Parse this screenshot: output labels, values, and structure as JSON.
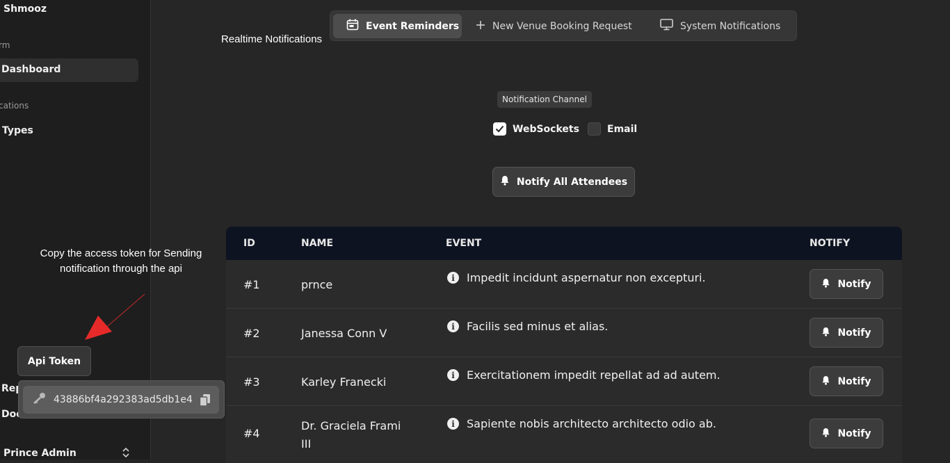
{
  "sidebar": {
    "brand": "Shmooz",
    "section_platform": "rm",
    "dashboard": "Dashboard",
    "section_notifications": "cations",
    "types": "Types",
    "reports_cut": "Rep",
    "docs_cut": "Doc",
    "user_name": "Prince Admin"
  },
  "tabs": [
    {
      "label": "Event Reminders",
      "icon": "calendar-icon"
    },
    {
      "label": "New Venue Booking Request",
      "icon": "plus-icon"
    },
    {
      "label": "System Notifications",
      "icon": "monitor-icon"
    }
  ],
  "realtime_label": "Realtime Notifications",
  "channel": {
    "badge": "Notification Channel",
    "websockets": "WebSockets",
    "email": "Email",
    "websockets_checked": true,
    "email_checked": false
  },
  "notify_all": "Notify All Attendees",
  "table": {
    "headers": {
      "id": "ID",
      "name": "NAME",
      "event": "EVENT",
      "notify": "NOTIFY"
    },
    "rows": [
      {
        "id": "#1",
        "name": "prnce",
        "event": "Impedit incidunt aspernatur non excepturi.",
        "action": "Notify"
      },
      {
        "id": "#2",
        "name": "Janessa Conn V",
        "event": "Facilis sed minus et alias.",
        "action": "Notify"
      },
      {
        "id": "#3",
        "name": "Karley Franecki",
        "event": "Exercitationem impedit repellat ad ad autem.",
        "action": "Notify"
      },
      {
        "id": "#4",
        "name": "Dr. Graciela Frami III",
        "event": "Sapiente nobis architecto architecto odio ab.",
        "action": "Notify"
      }
    ]
  },
  "annotation": "Copy the access token for Sending notification through the api",
  "api_token": {
    "button": "Api Token",
    "value": "43886bf4a292383ad5db1e4"
  },
  "colors": {
    "annotation_arrow": "#e62a2a",
    "table_header": "#0e1321"
  }
}
